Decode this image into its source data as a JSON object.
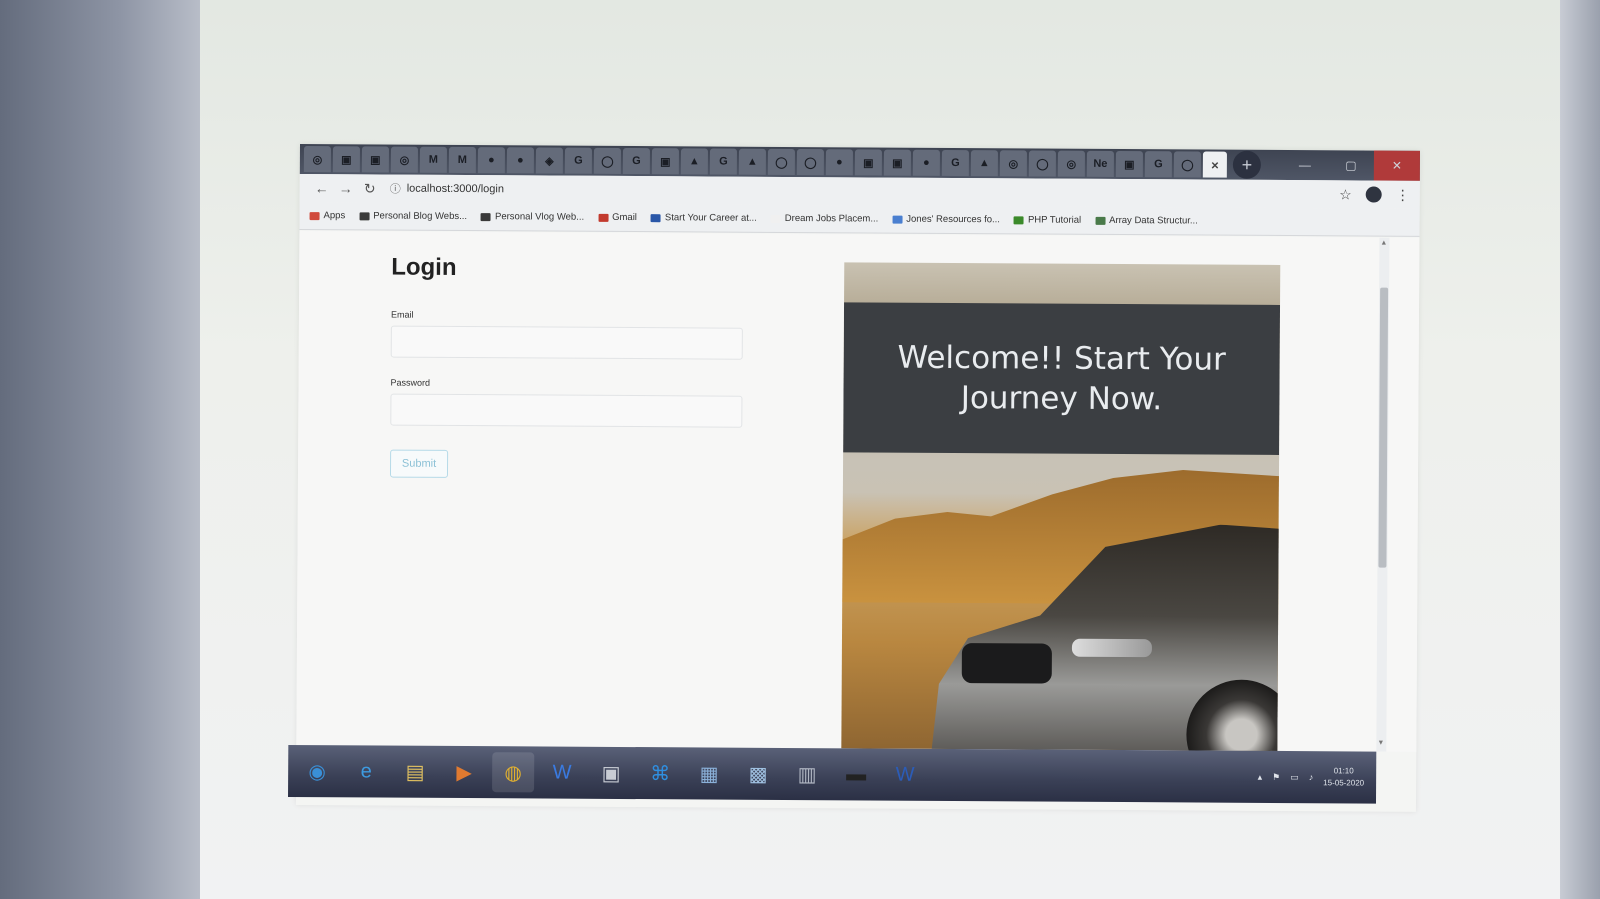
{
  "browser": {
    "tabs": [
      "◎",
      "▣",
      "▣",
      "◎",
      "M",
      "M",
      "●",
      "●",
      "◈",
      "G",
      "◯",
      "G",
      "▣",
      "▲",
      "G",
      "▲",
      "◯",
      "◯",
      "●",
      "▣",
      "▣",
      "●",
      "G",
      "▲",
      "◎",
      "◯",
      "◎",
      "Ne",
      "▣",
      "G",
      "◯"
    ],
    "active_tab_close": "×",
    "new_tab": "+",
    "window_buttons": [
      "—",
      "▢",
      "✕"
    ],
    "url": "localhost:3000/login"
  },
  "bookmarks": [
    {
      "label": "Apps",
      "color": "#d04a3c"
    },
    {
      "label": "Personal Blog Webs...",
      "color": "#3a3a3a"
    },
    {
      "label": "Personal Vlog Web...",
      "color": "#3a3a3a"
    },
    {
      "label": "Gmail",
      "color": "#c23a2e"
    },
    {
      "label": "Start Your Career at...",
      "color": "#2a57a8"
    },
    {
      "label": "Dream Jobs Placem...",
      "color": "#f0f0f0"
    },
    {
      "label": "Jones' Resources fo...",
      "color": "#4a7fd0"
    },
    {
      "label": "PHP Tutorial",
      "color": "#3b8a2a"
    },
    {
      "label": "Array Data Structur...",
      "color": "#4a7a4a"
    }
  ],
  "page": {
    "title": "Login",
    "email_label": "Email",
    "email_value": "",
    "password_label": "Password",
    "password_value": "",
    "submit_label": "Submit",
    "hero_text": "Welcome!! Start Your Journey Now."
  },
  "taskbar": {
    "apps": [
      "start",
      "ie",
      "explorer",
      "media",
      "chrome",
      "wps",
      "window",
      "vscode",
      "app",
      "app2",
      "app3",
      "cmd",
      "word"
    ],
    "clock_time": "01:10",
    "clock_date": "15-05-2020"
  }
}
